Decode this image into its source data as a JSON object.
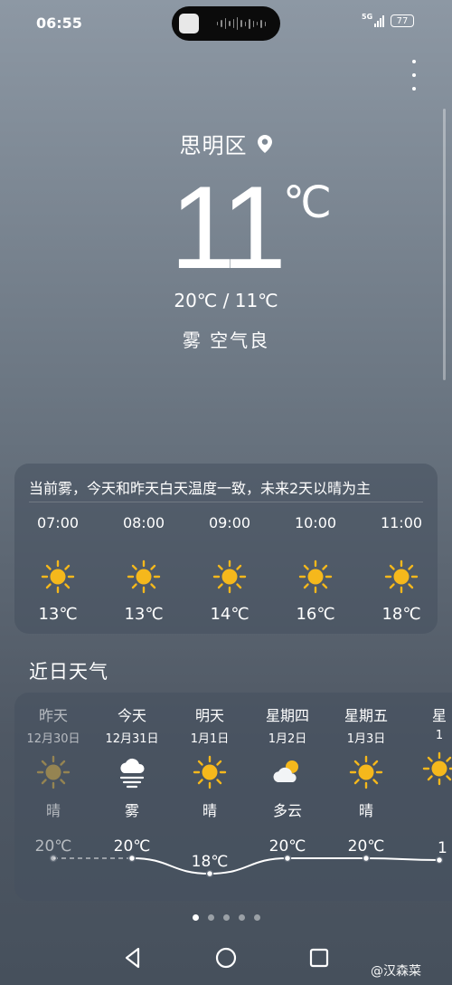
{
  "status_bar": {
    "time": "06:55",
    "network": "5G",
    "battery": "77"
  },
  "location": {
    "name": "思明区"
  },
  "current": {
    "temperature": "11",
    "unit": "℃",
    "hi_lo": "20℃ / 11℃",
    "condition": "雾 空气良"
  },
  "hourly": {
    "summary": "当前雾，今天和昨天白天温度一致，未来2天以晴为主",
    "items": [
      {
        "time": "07:00",
        "icon": "sun-icon",
        "temp": "13℃"
      },
      {
        "time": "08:00",
        "icon": "sun-icon",
        "temp": "13℃"
      },
      {
        "time": "09:00",
        "icon": "sun-icon",
        "temp": "14℃"
      },
      {
        "time": "10:00",
        "icon": "sun-icon",
        "temp": "16℃"
      },
      {
        "time": "11:00",
        "icon": "sun-icon",
        "temp": "18℃"
      }
    ]
  },
  "daily": {
    "title": "近日天气",
    "items": [
      {
        "day": "昨天",
        "date": "12月30日",
        "icon": "sun-icon",
        "condition": "晴",
        "high": "20℃",
        "high_value": 20
      },
      {
        "day": "今天",
        "date": "12月31日",
        "icon": "fog-icon",
        "condition": "雾",
        "high": "20℃",
        "high_value": 20
      },
      {
        "day": "明天",
        "date": "1月1日",
        "icon": "sun-icon",
        "condition": "晴",
        "high": "18℃",
        "high_value": 18
      },
      {
        "day": "星期四",
        "date": "1月2日",
        "icon": "partly-cloudy-icon",
        "condition": "多云",
        "high": "20℃",
        "high_value": 20
      },
      {
        "day": "星期五",
        "date": "1月3日",
        "icon": "sun-icon",
        "condition": "晴",
        "high": "20℃",
        "high_value": 20
      },
      {
        "day": "星",
        "date": "1",
        "icon": "sun-icon",
        "condition": "",
        "high": "1",
        "high_value": 19
      }
    ]
  },
  "pager": {
    "count": 5,
    "active": 0
  },
  "watermark": "@汉森菜",
  "colors": {
    "sun": "#f5b81c",
    "past_sun": "#c9a64a"
  }
}
